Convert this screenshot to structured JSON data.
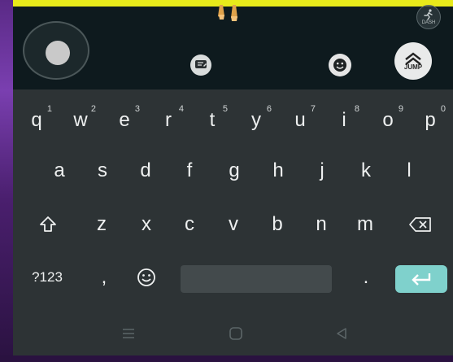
{
  "game": {
    "dash_label": "DASH",
    "jump_label": "JUMP",
    "accent_yellow": "#e8ea1a"
  },
  "keyboard": {
    "row1": [
      {
        "key": "q",
        "hint": "1"
      },
      {
        "key": "w",
        "hint": "2"
      },
      {
        "key": "e",
        "hint": "3"
      },
      {
        "key": "r",
        "hint": "4"
      },
      {
        "key": "t",
        "hint": "5"
      },
      {
        "key": "y",
        "hint": "6"
      },
      {
        "key": "u",
        "hint": "7"
      },
      {
        "key": "i",
        "hint": "8"
      },
      {
        "key": "o",
        "hint": "9"
      },
      {
        "key": "p",
        "hint": "0"
      }
    ],
    "row2": [
      "a",
      "s",
      "d",
      "f",
      "g",
      "h",
      "j",
      "k",
      "l"
    ],
    "row3": [
      "z",
      "x",
      "c",
      "v",
      "b",
      "n",
      "m"
    ],
    "symbols_label": "?123",
    "comma": ",",
    "period": ".",
    "enter_color": "#7fd1cc"
  },
  "navbar": {
    "icons": [
      "menu-icon",
      "home-icon",
      "back-icon"
    ]
  }
}
